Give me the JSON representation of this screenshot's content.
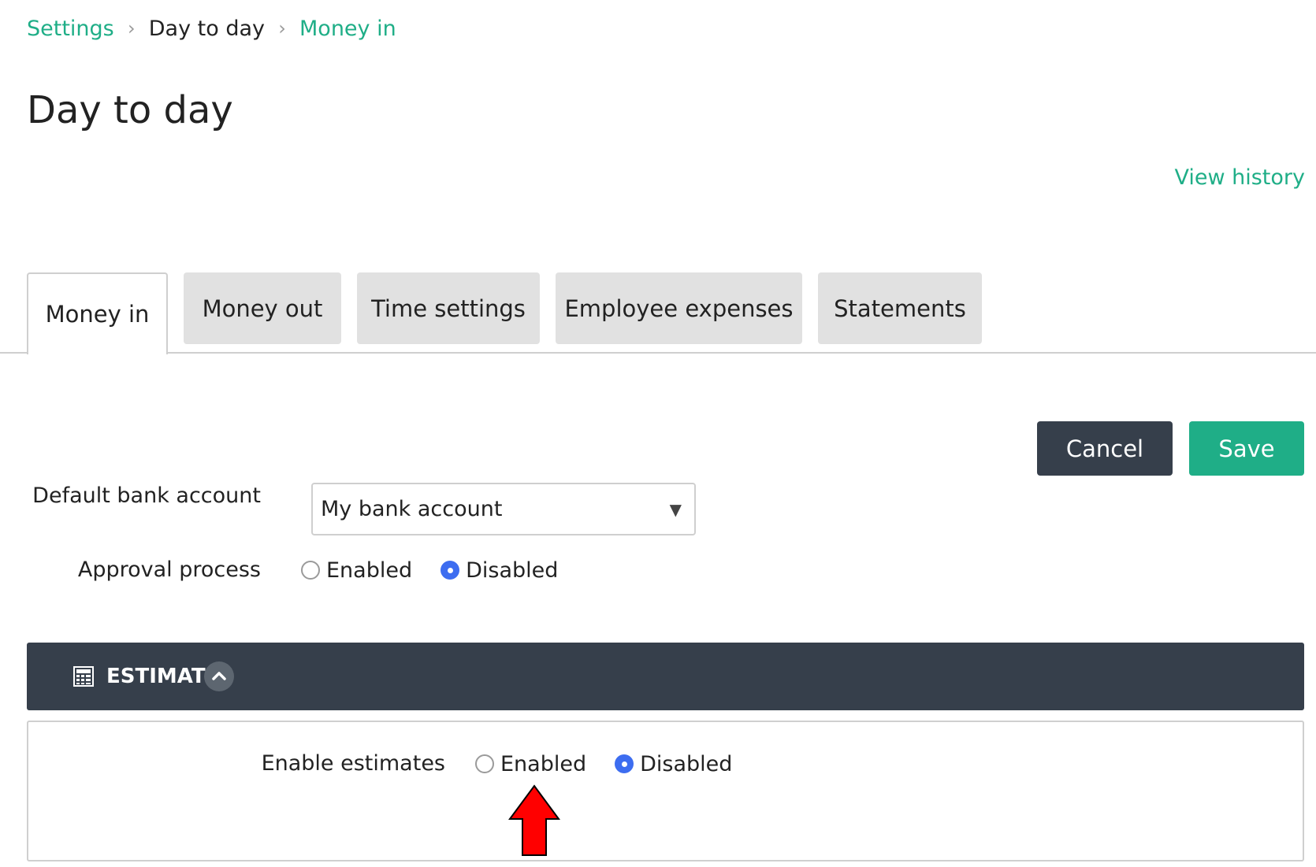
{
  "breadcrumb": {
    "items": [
      {
        "label": "Settings"
      },
      {
        "label": "Day to day"
      },
      {
        "label": "Money in"
      }
    ],
    "separator": "›"
  },
  "page": {
    "title": "Day to day",
    "view_history": "View history"
  },
  "tabs": [
    {
      "label": "Money in",
      "active": true
    },
    {
      "label": "Money out",
      "active": false
    },
    {
      "label": "Time settings",
      "active": false
    },
    {
      "label": "Employee expenses",
      "active": false
    },
    {
      "label": "Statements",
      "active": false
    }
  ],
  "actions": {
    "cancel": "Cancel",
    "save": "Save"
  },
  "form": {
    "default_bank_account": {
      "label": "Default bank account",
      "value": "My bank account",
      "arrow": "▼"
    },
    "approval_process": {
      "label": "Approval process",
      "options": [
        "Enabled",
        "Disabled"
      ],
      "selected": "Disabled"
    }
  },
  "estimates": {
    "title": "ESTIMATES",
    "enable_label": "Enable estimates",
    "options": [
      "Enabled",
      "Disabled"
    ],
    "selected": "Disabled"
  },
  "colors": {
    "accent_green": "#1fae87",
    "dark_header": "#363f4b",
    "radio_blue": "#3d6df0",
    "annotation_red": "#ff0000"
  },
  "icons": {
    "breadcrumb_separator": "chevron-right-icon",
    "estimates_header": "calculator-icon",
    "collapse": "chevron-up-icon",
    "dropdown": "triangle-down-icon",
    "annotation": "red-arrow-up-icon"
  }
}
